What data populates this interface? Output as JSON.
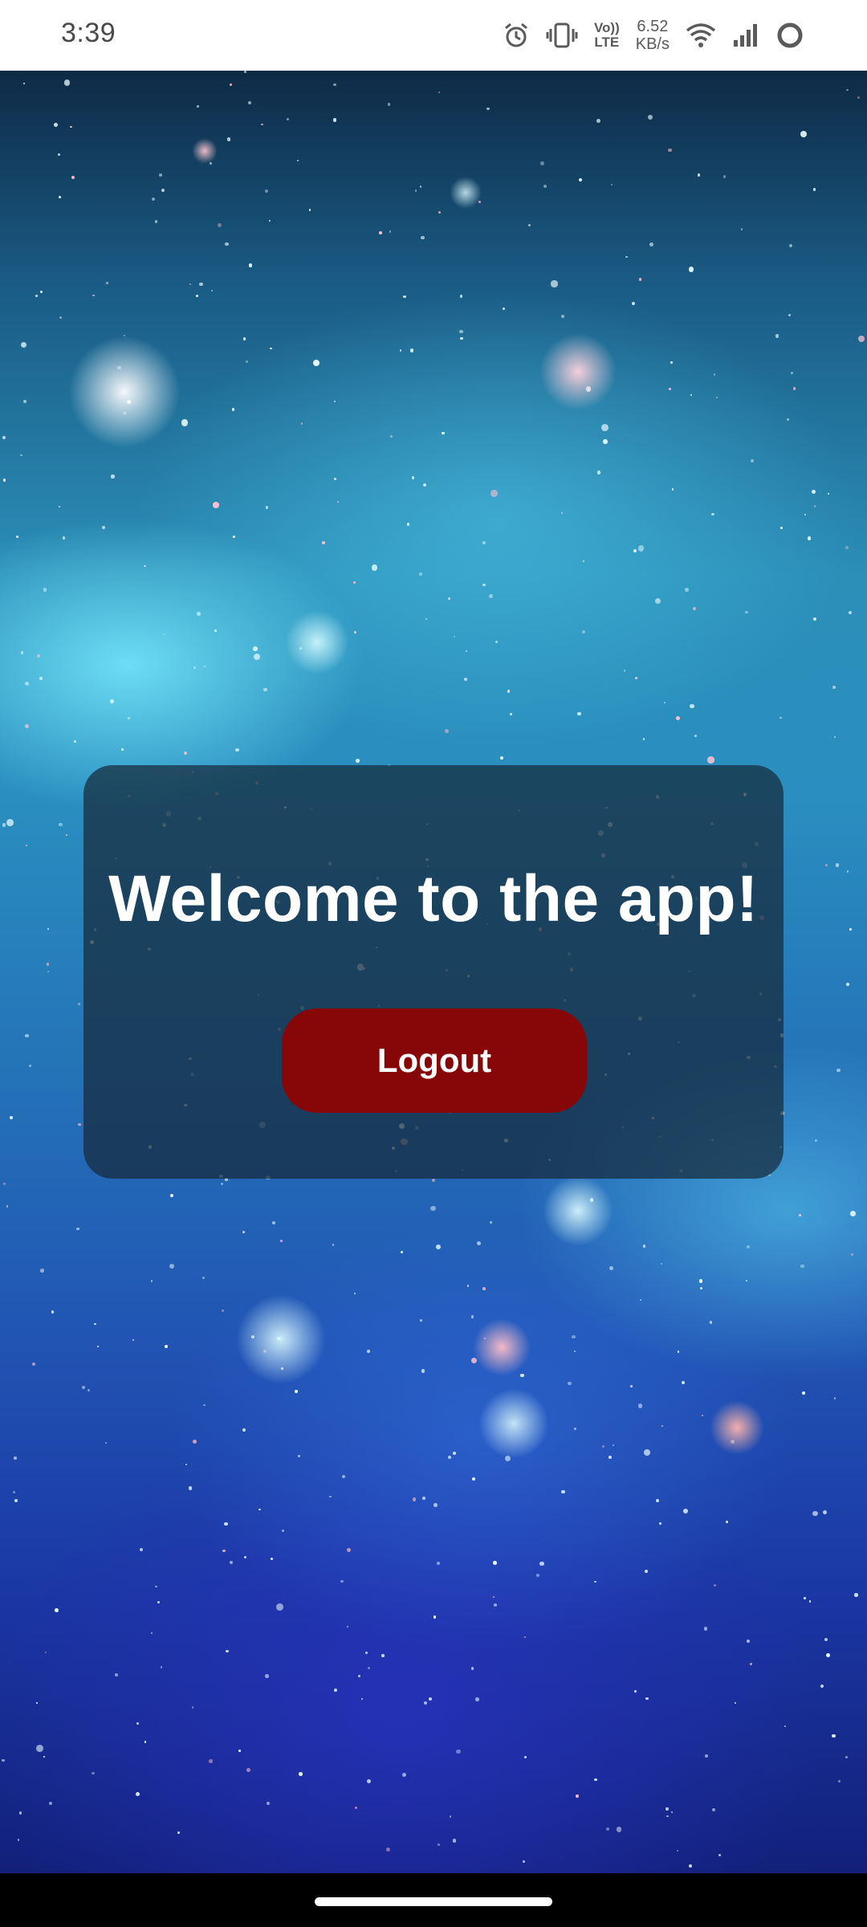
{
  "status_bar": {
    "time": "3:39",
    "network_speed_value": "6.52",
    "network_speed_unit": "KB/s",
    "volte_top": "Vo))",
    "volte_bottom": "LTE",
    "icons": [
      "alarm-icon",
      "vibrate-icon",
      "volte-icon",
      "wifi-icon",
      "signal-icon",
      "battery-ring-icon"
    ]
  },
  "main": {
    "welcome_text": "Welcome to the app!",
    "logout_label": "Logout"
  },
  "colors": {
    "logout_button": "#870709",
    "card_background": "rgba(22,42,58,0.72)",
    "status_bar_background": "#ffffff",
    "nav_bar_background": "#000000"
  }
}
